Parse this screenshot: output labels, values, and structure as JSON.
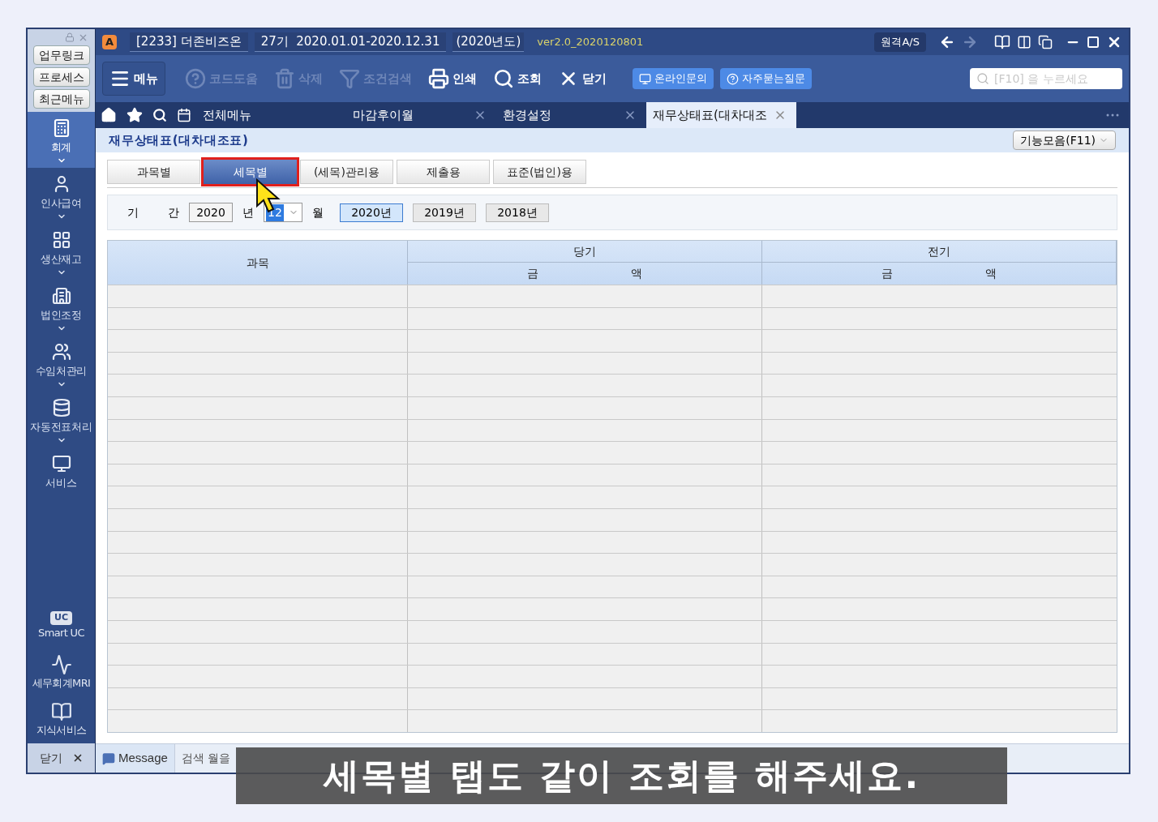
{
  "sidebar": {
    "top_buttons": [
      "업무링크",
      "프로세스",
      "최근메뉴"
    ],
    "modules": [
      {
        "label": "회계",
        "kind": "calc",
        "selected": true,
        "expandable": true
      },
      {
        "label": "인사급여",
        "kind": "person",
        "selected": false,
        "expandable": true
      },
      {
        "label": "생산재고",
        "kind": "grid",
        "selected": false,
        "expandable": true
      },
      {
        "label": "법인조정",
        "kind": "building",
        "selected": false,
        "expandable": true
      },
      {
        "label": "수임처관리",
        "kind": "people",
        "selected": false,
        "expandable": true
      },
      {
        "label": "자동전표처리",
        "kind": "db",
        "selected": false,
        "expandable": true
      },
      {
        "label": "서비스",
        "kind": "monitor",
        "selected": false,
        "expandable": false
      }
    ],
    "services": [
      {
        "label": "Smart UC",
        "kind": "uc",
        "badge": "UC"
      },
      {
        "label": "세무회계MRI",
        "kind": "pulse"
      },
      {
        "label": "지식서비스",
        "kind": "book"
      }
    ],
    "close": "닫기"
  },
  "title_bar": {
    "app_badge": "A",
    "company": "[2233] 더존비즈온",
    "period": "27기  2020.01.01-2020.12.31",
    "fiscal_year": "(2020년도)",
    "version": "ver2.0_2020120801",
    "remote": "원격A/S"
  },
  "toolbar": {
    "items": [
      {
        "label": "메뉴",
        "kind": "menu",
        "disabled": false
      },
      {
        "label": "코드도움",
        "kind": "help",
        "disabled": true
      },
      {
        "label": "삭제",
        "kind": "trash",
        "disabled": true
      },
      {
        "label": "조건검색",
        "kind": "filter",
        "disabled": true
      },
      {
        "label": "인쇄",
        "kind": "print",
        "disabled": false
      },
      {
        "label": "조회",
        "kind": "search",
        "disabled": false
      },
      {
        "label": "닫기",
        "kind": "close",
        "disabled": false
      }
    ],
    "links": [
      {
        "label": "온라인문의",
        "kind": "monitor"
      },
      {
        "label": "자주묻는질문",
        "kind": "question"
      }
    ],
    "search": {
      "placeholder": "[F10] 을 누르세요"
    }
  },
  "tabs": [
    {
      "label": "전체메뉴",
      "selected": false,
      "closable": false
    },
    {
      "label": "마감후이월",
      "selected": false,
      "closable": true
    },
    {
      "label": "환경설정",
      "selected": false,
      "closable": true
    },
    {
      "label": "재무상태표(대차대조",
      "selected": true,
      "closable": true
    }
  ],
  "page": {
    "title": "재무상태표(대차대조표)",
    "functions": "기능모음(F11)",
    "subtabs": [
      {
        "label": "과목별",
        "selected": false
      },
      {
        "label": "세목별",
        "selected": true
      },
      {
        "label": "(세목)관리용",
        "selected": false
      },
      {
        "label": "제출용",
        "selected": false
      },
      {
        "label": "표준(법인)용",
        "selected": false
      }
    ],
    "period": {
      "label_1": "기",
      "label_2": "간",
      "year": "2020",
      "year_unit": "년",
      "month": "12",
      "month_unit": "월",
      "years": [
        {
          "label": "2020년",
          "selected": true
        },
        {
          "label": "2019년",
          "selected": false
        },
        {
          "label": "2018년",
          "selected": false
        }
      ]
    },
    "table": {
      "columns": [
        {
          "label": "과목"
        },
        {
          "label": "당기",
          "sub": [
            "금",
            "액"
          ]
        },
        {
          "label": "전기",
          "sub": [
            "금",
            "액"
          ]
        }
      ]
    }
  },
  "status_bar": {
    "message": "Message",
    "hint": "검색 월을"
  },
  "caption": "세목별 탭도 같이 조회를 해주세요."
}
